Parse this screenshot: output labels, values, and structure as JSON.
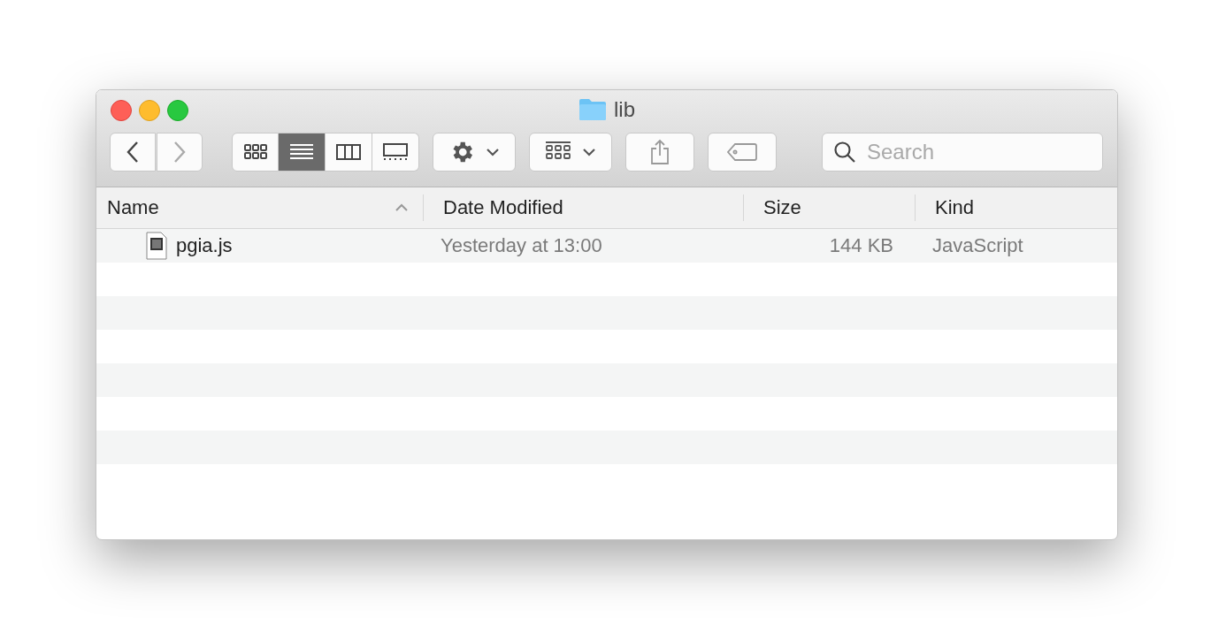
{
  "window": {
    "title": "lib"
  },
  "toolbar": {
    "view_modes": [
      {
        "selected": false
      },
      {
        "selected": true
      },
      {
        "selected": false
      },
      {
        "selected": false
      }
    ],
    "search": {
      "placeholder": "Search"
    }
  },
  "table": {
    "columns": [
      {
        "label": "Name",
        "sorted": true
      },
      {
        "label": "Date Modified",
        "sorted": false
      },
      {
        "label": "Size",
        "sorted": false
      },
      {
        "label": "Kind",
        "sorted": false
      }
    ],
    "rows": [
      {
        "name": "pgia.js",
        "date": "Yesterday at 13:00",
        "size": "144 KB",
        "kind": "JavaScript"
      }
    ]
  }
}
